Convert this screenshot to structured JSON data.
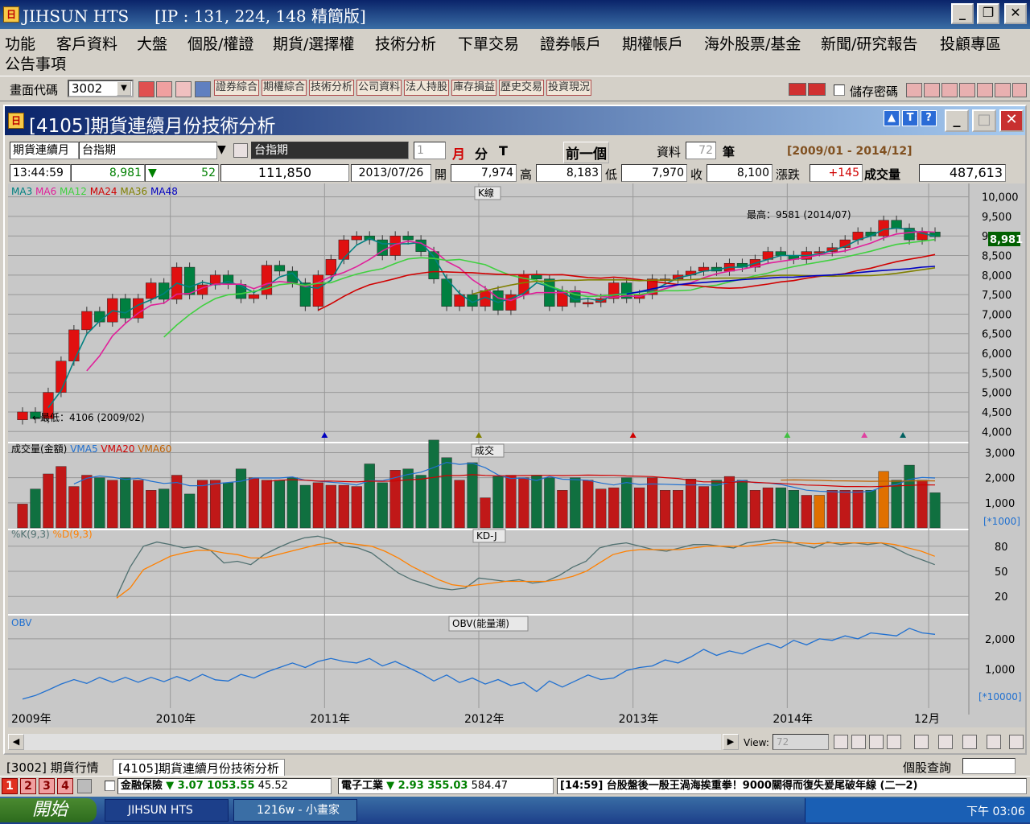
{
  "app": {
    "title": "JIHSUN HTS",
    "ip": "[IP : 131, 224, 148 精簡版]",
    "icon": "app-icon"
  },
  "window_buttons": {
    "minimize": "_",
    "restore": "❐",
    "close": "✕"
  },
  "menu": {
    "row1": [
      "功能",
      "客戶資料",
      "大盤",
      "個股/權證",
      "期貨/選擇權",
      "技術分析",
      "下單交易",
      "證券帳戶",
      "期權帳戶",
      "海外股票/基金",
      "新聞/研究報告",
      "投顧專區"
    ],
    "row2": [
      "公告事項"
    ]
  },
  "toolbar": {
    "code_label": "畫面代碼",
    "code_value": "3002",
    "quick_buttons": [
      "證券綜合",
      "期權綜合",
      "技術分析",
      "公司資料",
      "法人持股",
      "庫存損益",
      "歷史交易",
      "投資現況"
    ],
    "save_pwd_label": "儲存密碼"
  },
  "child": {
    "title": "[4105]期貨連續月份技術分析",
    "product_label": "期貨連續月",
    "product_value": "台指期",
    "product_name": "台指期",
    "period_value": "1",
    "period_buttons": [
      "月",
      "分",
      "T"
    ],
    "prev_button": "前一個",
    "data_label": "資料",
    "data_count": "72",
    "data_unit": "筆",
    "range": "[2009/01 - 2014/12]",
    "quote": {
      "time": "13:44:59",
      "price": "8,981",
      "arrow": "▼",
      "change": "52",
      "volume": "111,850",
      "date": "2013/07/26",
      "open_label": "開",
      "open": "7,974",
      "high_label": "高",
      "high": "8,183",
      "low_label": "低",
      "low": "7,970",
      "close_label": "收",
      "close": "8,100",
      "chg_label": "漲跌",
      "chg": "+145",
      "vol_label": "成交量",
      "vol": "487,613"
    }
  },
  "chart_data": [
    {
      "type": "candlestick",
      "title": "K線",
      "ma_labels": [
        "MA3",
        "MA6",
        "MA12",
        "MA24",
        "MA36",
        "MA48"
      ],
      "ma_colors": [
        "#008080",
        "#e0209a",
        "#40d040",
        "#d00000",
        "#808000",
        "#0000c0"
      ],
      "y_ticks": [
        "10,000",
        "9,500",
        "9,000",
        "8,500",
        "8,000",
        "7,500",
        "7,000",
        "6,500",
        "6,000",
        "5,500",
        "5,000",
        "4,500",
        "4,000"
      ],
      "ylim": [
        3800,
        10300
      ],
      "current_price": "8,981",
      "high_note": "最高：9581 (2014/07)",
      "low_note": "←最低：4106 (2009/02)",
      "closes": [
        4500,
        4330,
        5000,
        5800,
        6600,
        7070,
        6800,
        7400,
        6900,
        7400,
        7800,
        7380,
        8200,
        7500,
        7750,
        8000,
        7760,
        7400,
        7500,
        8250,
        8100,
        7800,
        7200,
        8000,
        8400,
        8900,
        9000,
        8900,
        8500,
        9000,
        8900,
        8600,
        7900,
        7200,
        7500,
        7200,
        7600,
        7100,
        7500,
        8000,
        7900,
        7200,
        7600,
        7300,
        7300,
        7400,
        7800,
        7400,
        7500,
        7900,
        7900,
        8000,
        8100,
        8200,
        8100,
        8300,
        8200,
        8400,
        8600,
        8500,
        8400,
        8600,
        8600,
        8700,
        8900,
        9100,
        9000,
        9400,
        9200,
        8900,
        9100,
        8981
      ],
      "opens": [
        4300,
        4500,
        4330,
        5000,
        5800,
        6600,
        7070,
        6800,
        7400,
        6900,
        7400,
        7800,
        7380,
        8200,
        7500,
        7750,
        8000,
        7760,
        7400,
        7500,
        8250,
        8100,
        7800,
        7200,
        8000,
        8400,
        8900,
        9000,
        8900,
        8500,
        9000,
        8900,
        8600,
        7900,
        7200,
        7500,
        7200,
        7600,
        7100,
        7500,
        8000,
        7900,
        7200,
        7600,
        7300,
        7300,
        7400,
        7800,
        7400,
        7500,
        7900,
        7900,
        8000,
        8100,
        8200,
        8100,
        8300,
        8200,
        8400,
        8600,
        8500,
        8400,
        8600,
        8600,
        8700,
        8900,
        9100,
        9000,
        9400,
        9200,
        8900,
        9100
      ]
    },
    {
      "type": "bar",
      "title": "成交",
      "label": "成交量(金額)",
      "vma_labels": [
        "VMA5",
        "VMA20",
        "VMA60"
      ],
      "vma_colors": [
        "#2070d0",
        "#d00000",
        "#c06000"
      ],
      "y_ticks": [
        "3,000",
        "2,000",
        "1,000"
      ],
      "unit": "[*1000]",
      "ylim": [
        0,
        3400
      ],
      "values": [
        950,
        1550,
        2150,
        2450,
        1650,
        2100,
        2000,
        1900,
        2000,
        1900,
        1500,
        1550,
        2100,
        1350,
        1900,
        1900,
        1800,
        2350,
        2000,
        1900,
        1900,
        2000,
        1700,
        1800,
        1700,
        1700,
        1650,
        2550,
        1800,
        2300,
        2350,
        2100,
        3500,
        2800,
        1900,
        2600,
        1200,
        2050,
        2100,
        2000,
        2100,
        2000,
        1500,
        2000,
        1900,
        1550,
        1600,
        2000,
        1600,
        2000,
        1500,
        1500,
        1950,
        1650,
        1900,
        2050,
        1900,
        1500,
        1600,
        1600,
        1500,
        1300,
        1300,
        1500,
        1500,
        1500,
        1500,
        2250,
        1900,
        2500,
        1900,
        1400
      ]
    },
    {
      "type": "line",
      "title": "KD-J",
      "series_names": [
        "%K(9,3)",
        "%D(9,3)"
      ],
      "colors": [
        "#507070",
        "#ff8000"
      ],
      "y_ticks": [
        "80",
        "50",
        "20"
      ],
      "ylim": [
        0,
        100
      ],
      "k": [
        null,
        null,
        null,
        null,
        null,
        null,
        null,
        20,
        55,
        80,
        85,
        82,
        78,
        80,
        75,
        60,
        62,
        58,
        70,
        78,
        85,
        90,
        92,
        88,
        80,
        78,
        72,
        60,
        48,
        40,
        35,
        30,
        28,
        30,
        42,
        40,
        38,
        40,
        36,
        38,
        45,
        55,
        62,
        78,
        82,
        84,
        80,
        76,
        74,
        78,
        82,
        82,
        80,
        78,
        84,
        86,
        88,
        86,
        82,
        78,
        85,
        82,
        84,
        82,
        84,
        78,
        70,
        64,
        58
      ],
      "d": [
        null,
        null,
        null,
        null,
        null,
        null,
        null,
        18,
        30,
        52,
        60,
        68,
        72,
        75,
        75,
        72,
        70,
        66,
        66,
        70,
        74,
        78,
        82,
        84,
        84,
        82,
        80,
        74,
        66,
        56,
        48,
        40,
        34,
        32,
        34,
        36,
        38,
        38,
        38,
        38,
        40,
        44,
        50,
        60,
        70,
        74,
        76,
        76,
        76,
        76,
        78,
        80,
        80,
        80,
        80,
        82,
        84,
        84,
        84,
        83,
        84,
        84,
        84,
        84,
        84,
        82,
        78,
        74,
        68
      ]
    },
    {
      "type": "line",
      "title": "OBV(能量潮)",
      "series_names": [
        "OBV"
      ],
      "colors": [
        "#2070d0"
      ],
      "y_ticks": [
        "2,000",
        "1,000"
      ],
      "unit": "[*10000]",
      "ylim": [
        -300,
        2800
      ],
      "values": [
        0,
        120,
        300,
        500,
        650,
        520,
        720,
        560,
        720,
        560,
        720,
        580,
        750,
        600,
        820,
        640,
        600,
        820,
        700,
        900,
        1050,
        1200,
        1050,
        1250,
        1350,
        1250,
        1200,
        1350,
        1100,
        1250,
        1050,
        850,
        600,
        800,
        550,
        700,
        500,
        650,
        450,
        550,
        250,
        600,
        400,
        600,
        800,
        650,
        700,
        950,
        1050,
        1100,
        1300,
        1200,
        1400,
        1650,
        1450,
        1600,
        1500,
        1700,
        1850,
        1700,
        1950,
        1800,
        2000,
        1950,
        2100,
        2000,
        2200,
        2150,
        2100,
        2350,
        2200,
        2150
      ]
    }
  ],
  "x_ticks": [
    "2009年",
    "2010年",
    "2011年",
    "2012年",
    "2013年",
    "2014年",
    "12月"
  ],
  "scroll": {
    "view_label": "View:",
    "view_value": "72"
  },
  "tabs": [
    "[3002] 期貨行情",
    "[4105]期貨連續月份技術分析"
  ],
  "stock_query_label": "個股查詢",
  "ticker": {
    "nums": [
      "1",
      "2",
      "3",
      "4"
    ],
    "sector1": "金融保險",
    "sector1_change": "▼ 3.07 1053.55",
    "sector1_vol": "45.52",
    "sector2": "電子工業",
    "sector2_change": "▼ 2.93 355.03",
    "sector2_vol": "584.47",
    "news": "[14:59] 台股盤後一殷王渦海挨重拳！9000關得而復失爰尾破年線 (二一2)"
  },
  "taskbar": {
    "start": "開始",
    "tasks": [
      "JIHSUN HTS",
      "1216w - 小畫家"
    ],
    "clock": "下午 03:06"
  }
}
